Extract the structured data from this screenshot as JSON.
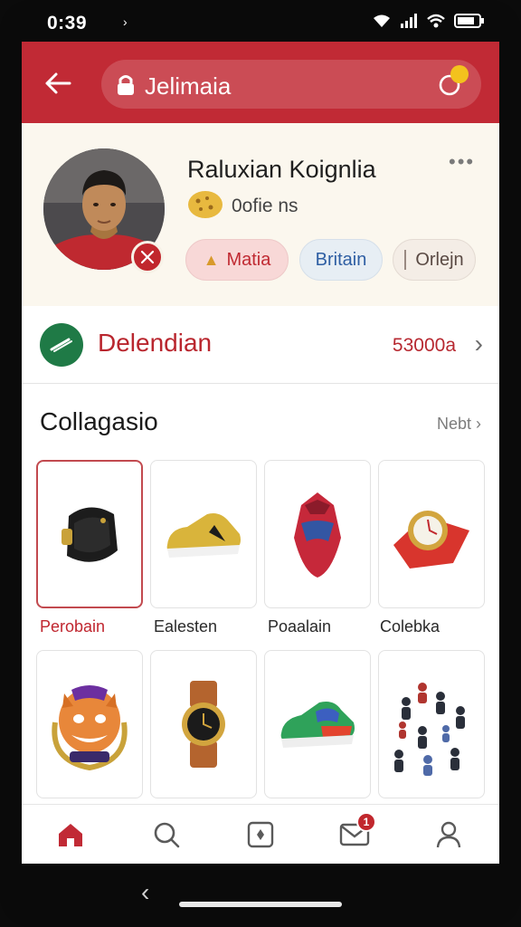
{
  "status_bar": {
    "time": "0:39",
    "arrow": "›"
  },
  "header": {
    "search_text": "Jelimaia",
    "bag_badge": ""
  },
  "profile": {
    "name": "Raluxian Koignlia",
    "subtitle": "0ofie ns",
    "chips": [
      {
        "label": "Matia"
      },
      {
        "label": "Britain"
      },
      {
        "label": "Orlejn"
      }
    ]
  },
  "delivery": {
    "label": "Delendian",
    "value": "53000a"
  },
  "collection": {
    "title": "Collagasio",
    "more_label": "Nebt",
    "items": [
      {
        "label": "Perobain",
        "icon": "watch-band-icon",
        "selected": true
      },
      {
        "label": "Ealesten",
        "icon": "gold-sneaker-icon"
      },
      {
        "label": "Poaalain",
        "icon": "mask-icon"
      },
      {
        "label": "Colebka",
        "icon": "watch-icon"
      },
      {
        "label": "",
        "icon": "tiger-mascot-icon"
      },
      {
        "label": "",
        "icon": "wristwatch-icon"
      },
      {
        "label": "",
        "icon": "sneaker-icon"
      },
      {
        "label": "",
        "icon": "figurines-icon"
      }
    ]
  },
  "nav": {
    "mail_badge": "1"
  },
  "colors": {
    "brand_red": "#c12a35",
    "bg": "#f6f6f6",
    "accent_green": "#1f7a46"
  }
}
